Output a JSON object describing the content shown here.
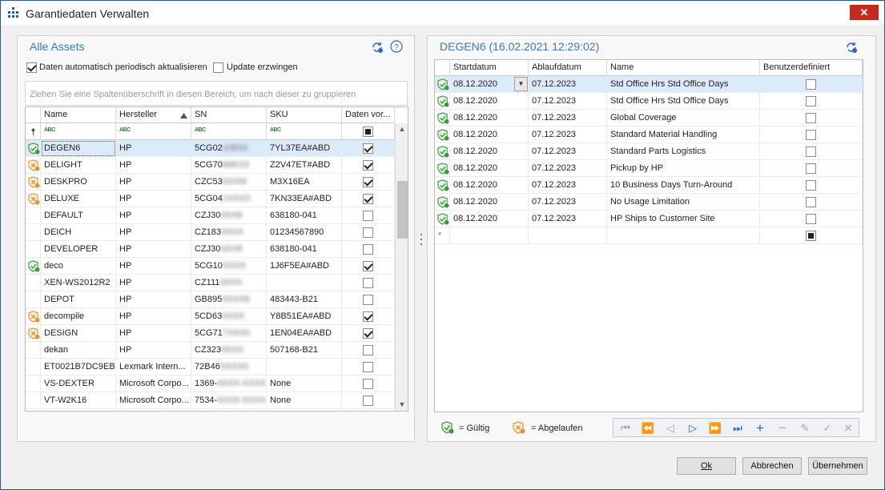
{
  "window": {
    "title": "Garantiedaten Verwalten",
    "close_glyph": "✕"
  },
  "left": {
    "title": "Alle Assets",
    "auto_update_label": "Daten automatisch periodisch aktualisieren",
    "auto_update_checked": true,
    "force_update_label": "Update erzwingen",
    "force_update_checked": false,
    "group_hint": "Ziehen Sie eine Spaltenüberschrift in diesen Bereich, um nach dieser zu gruppieren",
    "columns": [
      "Name",
      "Hersteller",
      "SN",
      "SKU",
      "Daten vor..."
    ],
    "filter_abc": "ABC",
    "rows": [
      {
        "status": "valid",
        "name": "DEGEN6",
        "maker": "HP",
        "sn": "5CG02",
        "sn_hidden": "1083X",
        "sku": "7YL37EA#ABD",
        "checked": true
      },
      {
        "status": "expired",
        "name": "DELIGHT",
        "maker": "HP",
        "sn": "5CG70",
        "sn_hidden": "80KX3",
        "sku": "Z2V47ET#ABD",
        "checked": true
      },
      {
        "status": "expired",
        "name": "DESKPRO",
        "maker": "HP",
        "sn": "CZC53",
        "sn_hidden": "0XXM",
        "sku": "M3X16EA",
        "checked": true
      },
      {
        "status": "expired",
        "name": "DELUXE",
        "maker": "HP",
        "sn": "5CG04",
        "sn_hidden": "1XXX3",
        "sku": "7KN33EA#ABD",
        "checked": true
      },
      {
        "status": "",
        "name": "DEFAULT",
        "maker": "HP",
        "sn": "CZJ30",
        "sn_hidden": "0XX8",
        "sku": "638180-041",
        "checked": false
      },
      {
        "status": "",
        "name": "DEICH",
        "maker": "HP",
        "sn": "CZ183",
        "sn_hidden": "0XXX",
        "sku": "01234567890",
        "checked": false
      },
      {
        "status": "",
        "name": "DEVELOPER",
        "maker": "HP",
        "sn": "CZJ30",
        "sn_hidden": "0XX8",
        "sku": "638180-041",
        "checked": false
      },
      {
        "status": "valid",
        "name": "deco",
        "maker": "HP",
        "sn": "5CG10",
        "sn_hidden": "XXXX",
        "sku": "1J6F5EA#ABD",
        "checked": true
      },
      {
        "status": "",
        "name": "XEN-WS2012R2",
        "maker": "HP",
        "sn": "CZ111",
        "sn_hidden": "0XXX",
        "sku": "",
        "checked": false
      },
      {
        "status": "",
        "name": "DEPOT",
        "maker": "HP",
        "sn": "GB895",
        "sn_hidden": "0XXX8",
        "sku": "483443-B21",
        "checked": false
      },
      {
        "status": "expired",
        "name": "decompile",
        "maker": "HP",
        "sn": "5CD63",
        "sn_hidden": "0XXX",
        "sku": "Y8B51EA#ABD",
        "checked": true
      },
      {
        "status": "expired",
        "name": "DESIGN",
        "maker": "HP",
        "sn": "5CG71",
        "sn_hidden": "7XXX0",
        "sku": "1EN04EA#ABD",
        "checked": true
      },
      {
        "status": "",
        "name": "dekan",
        "maker": "HP",
        "sn": "CZ323",
        "sn_hidden": "0XXX",
        "sku": "507168-B21",
        "checked": false
      },
      {
        "status": "",
        "name": "ET0021B7DC9EBE",
        "maker": "Lexmark Intern...",
        "sn": "72B46",
        "sn_hidden": "XXXX0",
        "sku": "",
        "checked": false
      },
      {
        "status": "",
        "name": "VS-DEXTER",
        "maker": "Microsoft Corpo...",
        "sn": "1369-",
        "sn_hidden": "0XXX-XXXX",
        "sku": "None",
        "checked": false
      },
      {
        "status": "",
        "name": "VT-W2K16",
        "maker": "Microsoft Corpo...",
        "sn": "7534-",
        "sn_hidden": "5XXX-XXXX",
        "sku": "None",
        "checked": false
      }
    ]
  },
  "right": {
    "title": "DEGEN6 (16.02.2021 12:29:02)",
    "columns": [
      "Startdatum",
      "Ablaufdatum",
      "Name",
      "Benutzerdefiniert"
    ],
    "rows": [
      {
        "start": "08.12.2020",
        "end": "07.12.2023",
        "name": "Std Office Hrs Std Office Days"
      },
      {
        "start": "08.12.2020",
        "end": "07.12.2023",
        "name": "Std Office Hrs Std Office Days"
      },
      {
        "start": "08.12.2020",
        "end": "07.12.2023",
        "name": "Global Coverage"
      },
      {
        "start": "08.12.2020",
        "end": "07.12.2023",
        "name": "Standard Material Handling"
      },
      {
        "start": "08.12.2020",
        "end": "07.12.2023",
        "name": "Standard Parts Logistics"
      },
      {
        "start": "08.12.2020",
        "end": "07.12.2023",
        "name": "Pickup by HP"
      },
      {
        "start": "08.12.2020",
        "end": "07.12.2023",
        "name": "10 Business Days Turn-Around"
      },
      {
        "start": "08.12.2020",
        "end": "07.12.2023",
        "name": "No Usage Limitation"
      },
      {
        "start": "08.12.2020",
        "end": "07.12.2023",
        "name": "HP Ships to Customer Site"
      }
    ],
    "new_row_marker": "*",
    "legend_valid": "= Gültig",
    "legend_expired": "= Abgelaufen"
  },
  "buttons": {
    "ok": "Ok",
    "cancel": "Abbrechen",
    "apply": "Übernehmen"
  },
  "colors": {
    "accent": "#3c78c3",
    "valid": "#3a9a3a",
    "expired": "#e8922a",
    "close": "#c42b1c"
  }
}
